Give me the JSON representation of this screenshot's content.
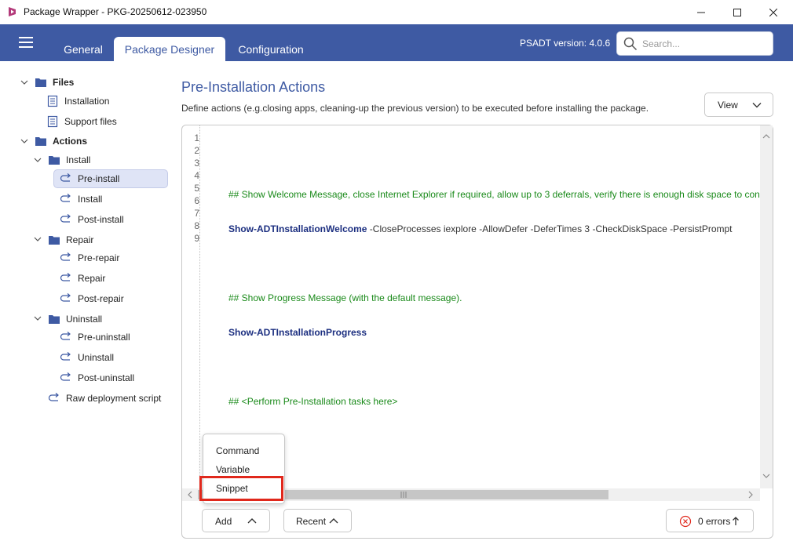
{
  "window": {
    "title": "Package Wrapper - PKG-20250612-023950"
  },
  "header": {
    "tabs": [
      {
        "label": "General"
      },
      {
        "label": "Package Designer"
      },
      {
        "label": "Configuration"
      }
    ],
    "psadt_version": "PSADT version: 4.0.6",
    "search_placeholder": "Search..."
  },
  "sidebar": {
    "files": "Files",
    "installation": "Installation",
    "support_files": "Support files",
    "actions": "Actions",
    "install_group": "Install",
    "pre_install": "Pre-install",
    "install": "Install",
    "post_install": "Post-install",
    "repair_group": "Repair",
    "pre_repair": "Pre-repair",
    "repair": "Repair",
    "post_repair": "Post-repair",
    "uninstall_group": "Uninstall",
    "pre_uninstall": "Pre-uninstall",
    "uninstall": "Uninstall",
    "post_uninstall": "Post-uninstall",
    "raw_script": "Raw deployment script"
  },
  "main": {
    "title": "Pre-Installation Actions",
    "description": "Define actions (e.g.closing apps, cleaning-up the previous version) to be executed before installing the package.",
    "view_label": "View"
  },
  "editor": {
    "line_numbers": [
      "1",
      "2",
      "3",
      "4",
      "5",
      "6",
      "7",
      "8",
      "9"
    ],
    "line2": "## Show Welcome Message, close Internet Explorer if required, allow up to 3 deferrals, verify there is enough disk space to con",
    "line3_cmd": "Show-ADTInstallationWelcome",
    "line3_args": " -CloseProcesses iexplore -AllowDefer -DeferTimes 3 -CheckDiskSpace -PersistPrompt",
    "line5": "## Show Progress Message (with the default message).",
    "line6_cmd": "Show-ADTInstallationProgress",
    "line8": "## <Perform Pre-Installation tasks here>"
  },
  "menu": {
    "command": "Command",
    "variable": "Variable",
    "snippet": "Snippet"
  },
  "footer": {
    "add_label": "Add",
    "recent_label": "Recent",
    "errors_label": "0 errors"
  },
  "colors": {
    "accent": "#3e5aa3",
    "comment": "#1a8a1a",
    "command": "#1c2f80",
    "highlight": "#e0281c",
    "error": "#e0281c"
  }
}
